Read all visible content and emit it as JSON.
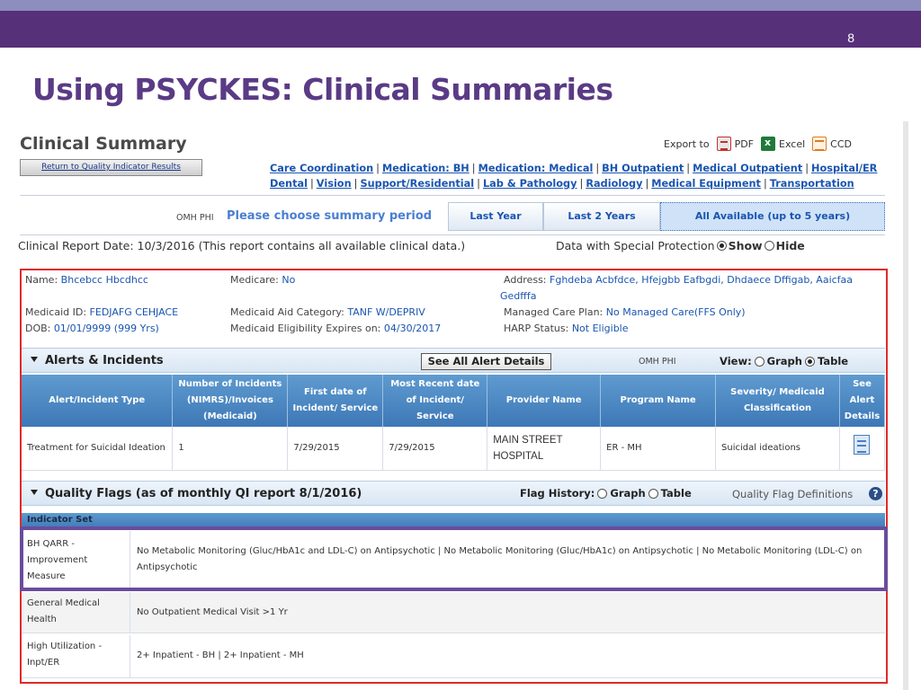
{
  "slide": {
    "number": "8",
    "title": "Using PSYCKES: Clinical Summaries"
  },
  "app": {
    "title": "Clinical Summary",
    "return_button": "Return to Quality Indicator Results",
    "export": {
      "label": "Export to",
      "pdf": "PDF",
      "excel": "Excel",
      "ccd": "CCD"
    },
    "nav_links": [
      "Care Coordination",
      "Medication: BH",
      "Medication: Medical",
      "BH Outpatient",
      "Medical Outpatient",
      "Hospital/ER",
      "Dental",
      "Vision",
      "Support/Residential",
      "Lab & Pathology",
      "Radiology",
      "Medical Equipment",
      "Transportation"
    ],
    "period": {
      "omh_phi": "OMH PHI",
      "prompt": "Please choose summary period",
      "tabs": [
        "Last Year",
        "Last 2 Years",
        "All Available (up to 5 years)"
      ],
      "active": "All Available (up to 5 years)"
    },
    "report_date": "Clinical Report Date: 10/3/2016  (This report contains all available clinical data.)",
    "special_protection": {
      "label": "Data with Special Protection",
      "show": "Show",
      "hide": "Hide",
      "selected": "Show"
    },
    "demographics": {
      "name_label": "Name:",
      "name": "Bhcebcc Hbcdhcc",
      "medicare_label": "Medicare:",
      "medicare": "No",
      "address_label": "Address:",
      "address_line1": "Fghdeba Acbfdce, Hfejgbb Eafbgdi, Dhdaece Dffigab, Aaicfaa",
      "address_line2": "Gedfffa",
      "medicaid_id_label": "Medicaid ID:",
      "medicaid_id": "FEDJAFG CEHJACE",
      "aid_category_label": "Medicaid Aid Category:",
      "aid_category": "TANF W/DEPRIV",
      "care_plan_label": "Managed Care Plan:",
      "care_plan": "No Managed Care(FFS Only)",
      "dob_label": "DOB:",
      "dob": "01/01/9999 (999 Yrs)",
      "eligibility_label": "Medicaid Eligibility Expires on:",
      "eligibility": "04/30/2017",
      "harp_label": "HARP Status:",
      "harp": "Not Eligible"
    },
    "alerts": {
      "title": "Alerts & Incidents",
      "see_all": "See All Alert Details",
      "omh_phi": "OMH PHI",
      "view_label": "View:",
      "graph": "Graph",
      "table": "Table",
      "selected_view": "Table",
      "columns": [
        "Alert/Incident Type",
        "Number of Incidents (NIMRS)/Invoices (Medicaid)",
        "First date of Incident/ Service",
        "Most Recent date of Incident/ Service",
        "Provider Name",
        "Program Name",
        "Severity/ Medicaid Classification",
        "See Alert Details"
      ],
      "rows": [
        {
          "type": "Treatment for Suicidal Ideation",
          "count": "1",
          "first_date": "7/29/2015",
          "recent_date": "7/29/2015",
          "provider": "MAIN STREET HOSPITAL",
          "program": "ER - MH",
          "severity": "Suicidal ideations"
        }
      ]
    },
    "quality_flags": {
      "title": "Quality Flags (as of monthly QI report 8/1/2016)",
      "flag_history_label": "Flag History:",
      "graph": "Graph",
      "table": "Table",
      "definitions": "Quality Flag Definitions",
      "indicator_header": "Indicator Set",
      "rows": [
        {
          "indicator": "BH QARR - Improvement Measure",
          "value": "No Metabolic Monitoring (Gluc/HbA1c and LDL-C) on Antipsychotic | No Metabolic Monitoring (Gluc/HbA1c) on Antipsychotic | No Metabolic Monitoring (LDL-C) on Antipsychotic"
        },
        {
          "indicator": "General Medical Health",
          "value": "No Outpatient Medical Visit >1 Yr"
        },
        {
          "indicator": "High Utilization - Inpt/ER",
          "value": "2+ Inpatient - BH | 2+ Inpatient - MH"
        }
      ]
    }
  },
  "colors": {
    "top_bar": "#57307a",
    "title": "#5a3b85",
    "link": "#1a55b0",
    "red_frame": "#e02a2a",
    "purple_frame": "#6a4c9c",
    "table_header": "#4a86c2"
  }
}
